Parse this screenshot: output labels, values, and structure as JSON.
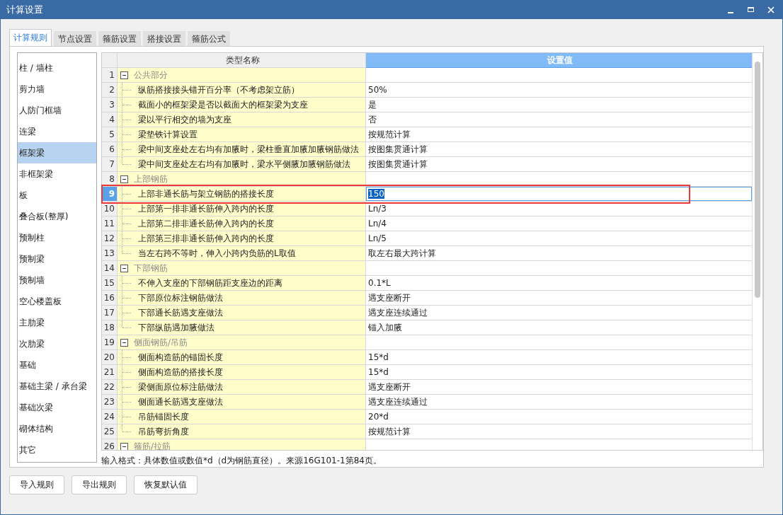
{
  "window": {
    "title": "计算设置"
  },
  "tabs": [
    {
      "label": "计算规则",
      "selected": true
    },
    {
      "label": "节点设置",
      "selected": false
    },
    {
      "label": "箍筋设置",
      "selected": false
    },
    {
      "label": "搭接设置",
      "selected": false
    },
    {
      "label": "箍筋公式",
      "selected": false
    }
  ],
  "sidebar": {
    "items": [
      {
        "label": "柱 / 墙柱",
        "selected": false
      },
      {
        "label": "剪力墙",
        "selected": false
      },
      {
        "label": "人防门框墙",
        "selected": false
      },
      {
        "label": "连梁",
        "selected": false
      },
      {
        "label": "框架梁",
        "selected": true
      },
      {
        "label": "非框架梁",
        "selected": false
      },
      {
        "label": "板",
        "selected": false
      },
      {
        "label": "叠合板(整厚)",
        "selected": false
      },
      {
        "label": "预制柱",
        "selected": false
      },
      {
        "label": "预制梁",
        "selected": false
      },
      {
        "label": "预制墙",
        "selected": false
      },
      {
        "label": "空心楼盖板",
        "selected": false
      },
      {
        "label": "主肋梁",
        "selected": false
      },
      {
        "label": "次肋梁",
        "selected": false
      },
      {
        "label": "基础",
        "selected": false
      },
      {
        "label": "基础主梁 / 承台梁",
        "selected": false
      },
      {
        "label": "基础次梁",
        "selected": false
      },
      {
        "label": "砌体结构",
        "selected": false
      },
      {
        "label": "其它",
        "selected": false
      }
    ]
  },
  "table": {
    "columns": [
      {
        "label": "类型名称",
        "selected": false
      },
      {
        "label": "设置值",
        "selected": true
      }
    ],
    "rows": [
      {
        "number": "1",
        "name": "公共部分",
        "expanded": true,
        "selected": false,
        "children": [
          {
            "number": "2",
            "name": "纵筋搭接接头错开百分率（不考虑架立筋）",
            "value": "50%",
            "selected": false
          },
          {
            "number": "3",
            "name": "截面小的框架梁是否以截面大的框架梁为支座",
            "value": "是",
            "selected": false
          },
          {
            "number": "4",
            "name": "梁以平行相交的墙为支座",
            "value": "否",
            "selected": false
          },
          {
            "number": "5",
            "name": "梁垫铁计算设置",
            "value": "按规范计算",
            "selected": false
          },
          {
            "number": "6",
            "name": "梁中间支座处左右均有加腋时，梁柱垂直加腋加腋钢筋做法",
            "value": "按图集贯通计算",
            "selected": false
          },
          {
            "number": "7",
            "name": "梁中间支座处左右均有加腋时，梁水平侧腋加腋钢筋做法",
            "value": "按图集贯通计算",
            "selected": false
          }
        ]
      },
      {
        "number": "8",
        "name": "上部钢筋",
        "expanded": true,
        "selected": false,
        "children": [
          {
            "number": "9",
            "name": "上部非通长筋与架立钢筋的搭接长度",
            "value": "150",
            "selected": true
          },
          {
            "number": "10",
            "name": "上部第一排非通长筋伸入跨内的长度",
            "value": "Ln/3",
            "selected": false
          },
          {
            "number": "11",
            "name": "上部第二排非通长筋伸入跨内的长度",
            "value": "Ln/4",
            "selected": false
          },
          {
            "number": "12",
            "name": "上部第三排非通长筋伸入跨内的长度",
            "value": "Ln/5",
            "selected": false
          },
          {
            "number": "13",
            "name": "当左右跨不等时，伸入小跨内负筋的L取值",
            "value": "取左右最大跨计算",
            "selected": false
          }
        ]
      },
      {
        "number": "14",
        "name": "下部钢筋",
        "expanded": true,
        "selected": false,
        "children": [
          {
            "number": "15",
            "name": "不伸入支座的下部钢筋距支座边的距离",
            "value": "0.1*L",
            "selected": false
          },
          {
            "number": "16",
            "name": "下部原位标注钢筋做法",
            "value": "遇支座断开",
            "selected": false
          },
          {
            "number": "17",
            "name": "下部通长筋遇支座做法",
            "value": "遇支座连续通过",
            "selected": false
          },
          {
            "number": "18",
            "name": "下部纵筋遇加腋做法",
            "value": "锚入加腋",
            "selected": false
          }
        ]
      },
      {
        "number": "19",
        "name": "侧面钢筋/吊筋",
        "expanded": true,
        "selected": false,
        "children": [
          {
            "number": "20",
            "name": "侧面构造筋的锚固长度",
            "value": "15*d",
            "selected": false
          },
          {
            "number": "21",
            "name": "侧面构造筋的搭接长度",
            "value": "15*d",
            "selected": false
          },
          {
            "number": "22",
            "name": "梁侧面原位标注筋做法",
            "value": "遇支座断开",
            "selected": false
          },
          {
            "number": "23",
            "name": "侧面通长筋遇支座做法",
            "value": "遇支座连续通过",
            "selected": false
          },
          {
            "number": "24",
            "name": "吊筋锚固长度",
            "value": "20*d",
            "selected": false
          },
          {
            "number": "25",
            "name": "吊筋弯折角度",
            "value": "按规范计算",
            "selected": false
          }
        ]
      },
      {
        "number": "26",
        "name": "箍筋/拉筋",
        "expanded": true,
        "selected": false,
        "children": []
      }
    ]
  },
  "hint": "输入格式：具体数值或数值*d（d为钢筋直径）。来源16G101-1第84页。",
  "buttons": [
    "导入规则",
    "导出规则",
    "恢复默认值"
  ]
}
